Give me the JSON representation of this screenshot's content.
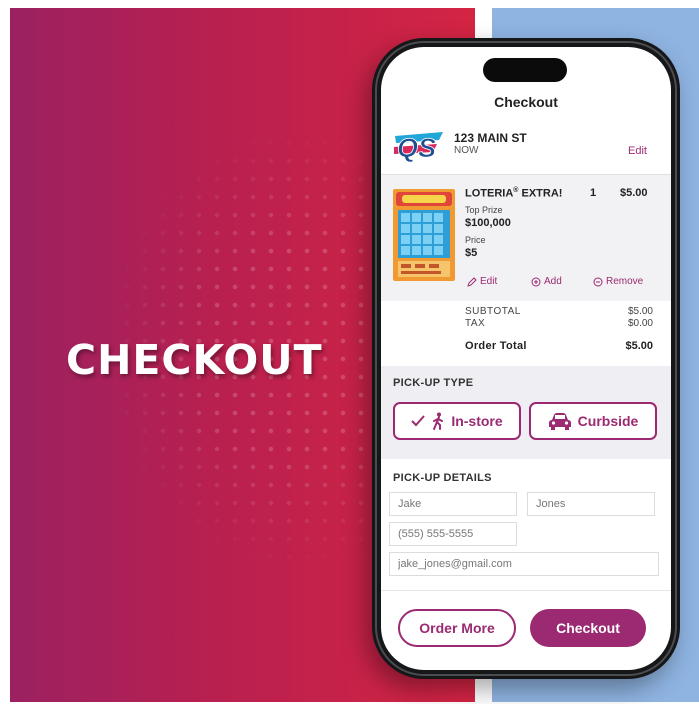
{
  "colors": {
    "accent": "#9b2a72",
    "banner_left": "#9b2161",
    "banner_right": "#d42443",
    "blue_panel": "#8fb4e2",
    "panel_gray": "#f2f1f4"
  },
  "banner": {
    "title": "CHECKOUT"
  },
  "screen": {
    "title": "Checkout"
  },
  "store": {
    "logo_text": "QS",
    "name": "123 MAIN ST",
    "time": "NOW",
    "edit_label": "Edit"
  },
  "cart_item": {
    "name": "LOTERIA",
    "name_mark": "®",
    "name_suffix": " EXTRA!",
    "quantity": "1",
    "price": "$5.00",
    "top_prize_label": "Top Prize",
    "top_prize_value": "$100,000",
    "price_label": "Price",
    "price_value": "$5",
    "actions": {
      "edit": "Edit",
      "add": "Add",
      "remove": "Remove"
    }
  },
  "summary": {
    "subtotal_label": "SUBTOTAL",
    "subtotal_value": "$5.00",
    "tax_label": "TAX",
    "tax_value": "$0.00",
    "total_label": "Order Total",
    "total_value": "$5.00"
  },
  "pickup_type": {
    "heading": "PICK-UP TYPE",
    "instore_label": "In-store",
    "curbside_label": "Curbside",
    "selected": "In-store"
  },
  "pickup_details": {
    "heading": "PICK-UP DETAILS",
    "first_name": "Jake",
    "last_name": "Jones",
    "phone": "(555) 555-5555",
    "email": "jake_jones@gmail.com"
  },
  "buttons": {
    "order_more": "Order More",
    "checkout": "Checkout"
  }
}
